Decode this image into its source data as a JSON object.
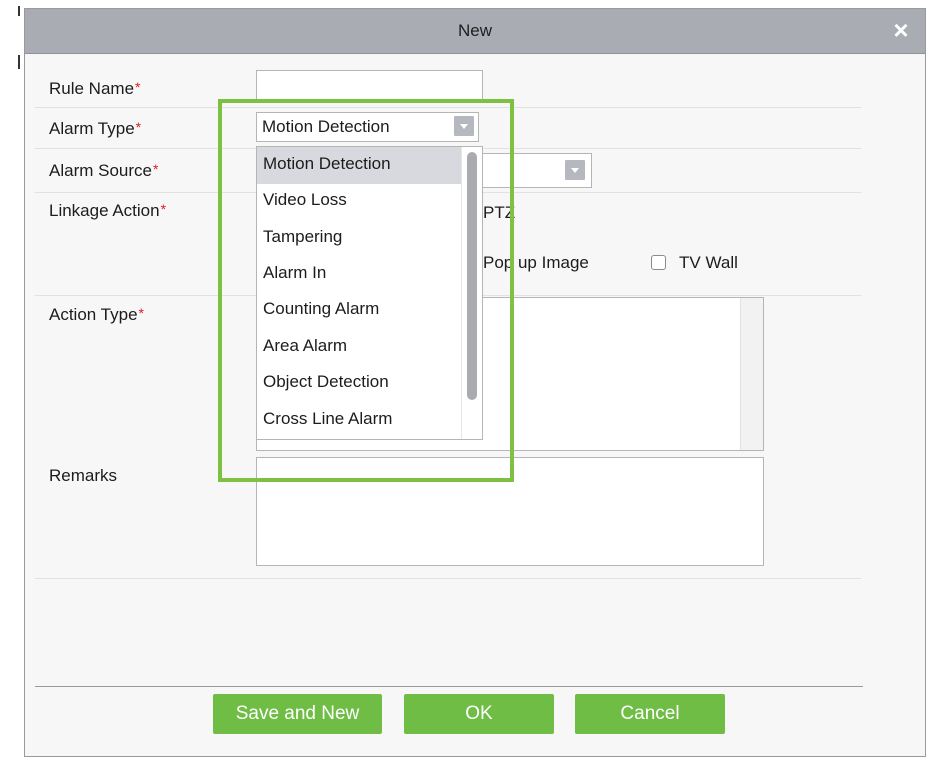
{
  "dialog": {
    "title": "New",
    "close_symbol": "×"
  },
  "form": {
    "rule_name": {
      "label": "Rule Name",
      "required": "*",
      "value": ""
    },
    "alarm_type": {
      "label": "Alarm Type",
      "required": "*",
      "selected": "Motion Detection"
    },
    "alarm_source": {
      "label": "Alarm Source",
      "required": "*"
    },
    "linkage_action": {
      "label": "Linkage Action",
      "required": "*",
      "options": [
        {
          "label": "PTZ"
        },
        {
          "label": "Pop up Image"
        },
        {
          "label": "TV Wall"
        }
      ]
    },
    "action_type": {
      "label": "Action Type",
      "required": "*"
    },
    "remarks": {
      "label": "Remarks",
      "value": ""
    }
  },
  "dropdown": {
    "items": [
      {
        "label": "Motion Detection",
        "selected": true
      },
      {
        "label": "Video Loss"
      },
      {
        "label": "Tampering"
      },
      {
        "label": "Alarm In"
      },
      {
        "label": "Counting Alarm"
      },
      {
        "label": "Area Alarm"
      },
      {
        "label": "Object Detection"
      },
      {
        "label": "Cross Line Alarm"
      }
    ]
  },
  "buttons": {
    "save_and_new": "Save and New",
    "ok": "OK",
    "cancel": "Cancel"
  },
  "colors": {
    "accent_green": "#6fbd45",
    "highlight_green": "#7cc142",
    "required_red": "#e11a1a",
    "titlebar": "#a9adb3"
  }
}
